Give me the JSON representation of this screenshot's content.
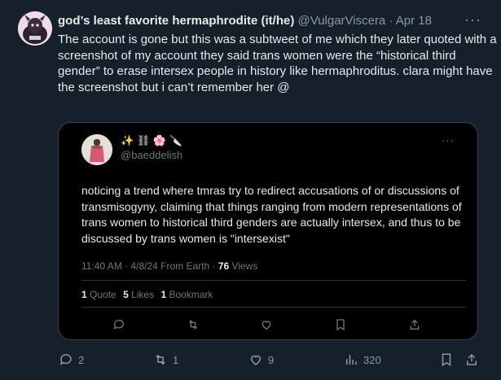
{
  "tweet": {
    "display_name": "god’s least favorite hermaphrodite (it/he)",
    "handle": "@VulgarViscera",
    "separator": "·",
    "date": "Apr 18",
    "more_label": "···",
    "text": "The account is gone but this was a subtweet of me which they later quoted with a screenshot of my account they said trans women were the “historical third gender” to erase intersex people in history like hermaphroditus. clara might have the screenshot but i can’t remember her @"
  },
  "quote": {
    "display_name": "✨ ⛓ 🌸 🔪",
    "handle": "@baeddelish",
    "more_label": "···",
    "text": "noticing a trend where tmras try to redirect accusations of or discussions of transmisogyny, claiming that things ranging from modern representations of trans women to historical third genders are actually intersex, and thus to be discussed by trans women is \"intersexist\"",
    "meta_time": "11:40 AM · 4/8/24 From Earth · ",
    "views_count": "76",
    "views_label": " Views",
    "quotes_count": "1",
    "quotes_label": " Quote",
    "likes_count": "5",
    "likes_label": " Likes",
    "bookmarks_count": "1",
    "bookmarks_label": " Bookmark",
    "actions": [
      "reply-icon",
      "retweet-icon",
      "like-icon",
      "bookmark-icon",
      "share-icon"
    ]
  },
  "actions": {
    "replies": "2",
    "retweets": "1",
    "likes": "9",
    "views": "320"
  },
  "colors": {
    "background": "#15202b",
    "quote_background": "#000000",
    "text": "#e7e9ea",
    "muted": "#8b98a5",
    "border": "#38444d"
  }
}
